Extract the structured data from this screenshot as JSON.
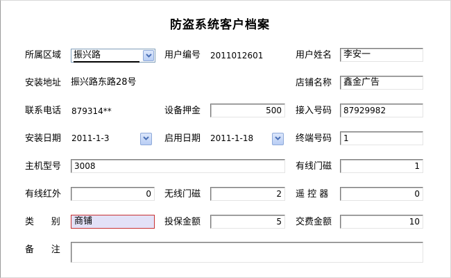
{
  "title": "防盗系统客户档案",
  "fields": {
    "district": {
      "label": "所属区域",
      "value": "振兴路"
    },
    "user_id": {
      "label": "用户编号",
      "value": "2011012601"
    },
    "user_name": {
      "label": "用户姓名",
      "value": "李安一"
    },
    "address": {
      "label": "安装地址",
      "value": "振兴路东路28号"
    },
    "shop_name": {
      "label": "店铺名称",
      "value": "鑫金广告"
    },
    "phone": {
      "label": "联系电话",
      "value": "879314**"
    },
    "deposit": {
      "label": "设备押金",
      "value": "500"
    },
    "access_no": {
      "label": "接入号码",
      "value": "87929982"
    },
    "install_date": {
      "label": "安装日期",
      "value": "2011-1-3"
    },
    "enable_date": {
      "label": "启用日期",
      "value": "2011-1-18"
    },
    "terminal_no": {
      "label": "终端号码",
      "value": "1"
    },
    "host_model": {
      "label": "主机型号",
      "value": "3008"
    },
    "wired_door": {
      "label": "有线门磁",
      "value": "1"
    },
    "wired_ir": {
      "label": "有线红外",
      "value": "0"
    },
    "wireless_door": {
      "label": "无线门磁",
      "value": "2"
    },
    "remote": {
      "label": "遥 控 器",
      "value": "0"
    },
    "category": {
      "label": "类      别",
      "value": "商铺"
    },
    "insured": {
      "label": "投保金额",
      "value": "5"
    },
    "paid": {
      "label": "交费金额",
      "value": "10"
    },
    "remark": {
      "label": "备      注",
      "value": ""
    }
  },
  "icons": {
    "dropdown": "chevron-down-icon"
  },
  "colors": {
    "selected_bg": "#e3e1f7",
    "selected_border": "#c83030",
    "dropdown_blue": "#4a6fb5"
  }
}
